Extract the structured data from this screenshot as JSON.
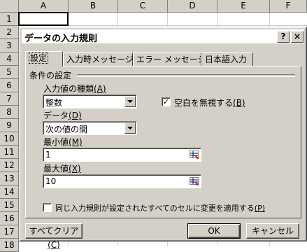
{
  "sheet": {
    "columns": [
      "A",
      "B",
      "C",
      "D",
      "E",
      "F"
    ],
    "rows": [
      "1",
      "2",
      "3",
      "4",
      "5",
      "6",
      "7",
      "8",
      "9",
      "10",
      "11",
      "12",
      "13",
      "14",
      "15",
      "16",
      "17",
      "18"
    ]
  },
  "dialog": {
    "title": "データの入力規則",
    "help_glyph": "?",
    "close_glyph": "×",
    "tabs": [
      {
        "label": "設定"
      },
      {
        "label": "入力時メッセージ"
      },
      {
        "label": "エラー メッセージ"
      },
      {
        "label": "日本語入力"
      }
    ],
    "group_label": "条件の設定",
    "type_label": "入力値の種類",
    "type_key": "(A)",
    "type_value": "整数",
    "ignore_blank_label": "空白を無視する",
    "ignore_blank_key": "(B)",
    "ignore_blank_checked": "✓",
    "data_label": "データ",
    "data_key": "(D)",
    "data_value": "次の値の間",
    "min_label": "最小値",
    "min_key": "(M)",
    "min_value": "1",
    "max_label": "最大値",
    "max_key": "(X)",
    "max_value": "10",
    "apply_all_label": "同じ入力規則が設定されたすべてのセルに変更を適用する",
    "apply_all_key": "(P)",
    "clear_all_label": "すべてクリア",
    "clear_all_key": "(C)",
    "ok_label": "OK",
    "cancel_label": "キャンセル"
  }
}
